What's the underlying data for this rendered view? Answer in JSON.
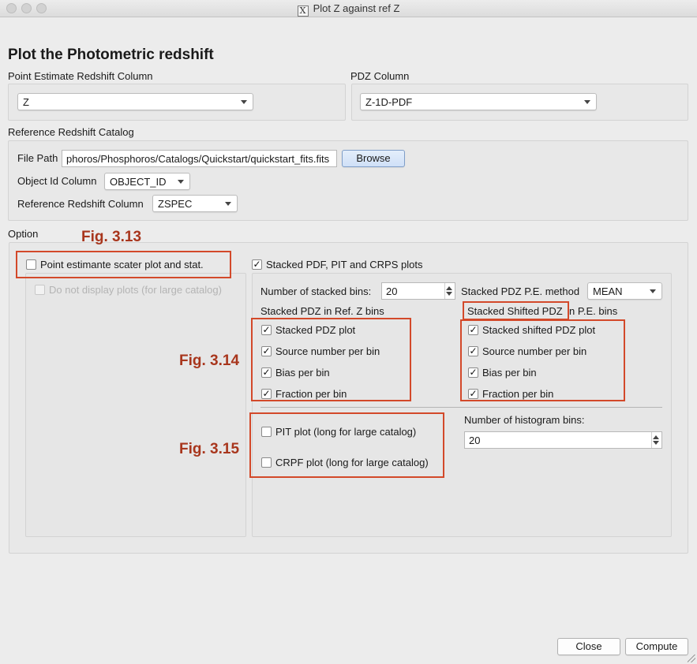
{
  "window": {
    "title": "Plot Z against ref Z",
    "logo": "X"
  },
  "heading": "Plot the Photometric redshift",
  "point_estimate": {
    "label": "Point Estimate  Redshift Column",
    "value": "Z"
  },
  "pdz": {
    "label": "PDZ Column",
    "value": "Z-1D-PDF"
  },
  "reference": {
    "label": "Reference Redshift Catalog",
    "file_path_label": "File Path",
    "file_path_value": "phoros/Phosphoros/Catalogs/Quickstart/quickstart_fits.fits",
    "browse_label": "Browse",
    "object_id_label": "Object Id Column",
    "object_id_value": "OBJECT_ID",
    "ref_column_label": "Reference Redshift Column",
    "ref_column_value": "ZSPEC"
  },
  "option": {
    "label": "Option",
    "point_scatter_label": "Point estimante scater plot and stat.",
    "point_scatter_checked": false,
    "do_not_display_label": "Do not display plots (for large catalog)",
    "do_not_display_checked": false,
    "stacked_label": "Stacked PDF, PIT and CRPS plots",
    "stacked_checked": true,
    "num_bins_label": "Number of stacked bins:",
    "num_bins_value": "20",
    "pe_method_label": "Stacked PDZ P.E. method",
    "pe_method_value": "MEAN",
    "ref_z_bins_label": "Stacked PDZ in Ref. Z bins",
    "pe_bins_label": "n P.E. bins",
    "shifted_overlay_label": "Stacked Shifted PDZ",
    "left_checks": [
      {
        "label": "Stacked PDZ plot",
        "checked": true
      },
      {
        "label": "Source number per bin",
        "checked": true
      },
      {
        "label": "Bias per bin",
        "checked": true
      },
      {
        "label": "Fraction per bin",
        "checked": true
      }
    ],
    "right_checks": [
      {
        "label": "Stacked shifted PDZ plot",
        "checked": true
      },
      {
        "label": "Source number per bin",
        "checked": true
      },
      {
        "label": "Bias per bin",
        "checked": true
      },
      {
        "label": "Fraction per bin",
        "checked": true
      }
    ],
    "pit_label": "PIT plot (long for large catalog)",
    "pit_checked": false,
    "crpf_label": "CRPF plot (long for large catalog)",
    "crpf_checked": false,
    "hist_bins_label": "Number of histogram bins:",
    "hist_bins_value": "20"
  },
  "figures": {
    "f313": "Fig. 3.13",
    "f314": "Fig. 3.14",
    "f315": "Fig. 3.15"
  },
  "buttons": {
    "close": "Close",
    "compute": "Compute"
  },
  "colors": {
    "annotation": "#d3492a",
    "annotation_text": "#a8361d"
  }
}
